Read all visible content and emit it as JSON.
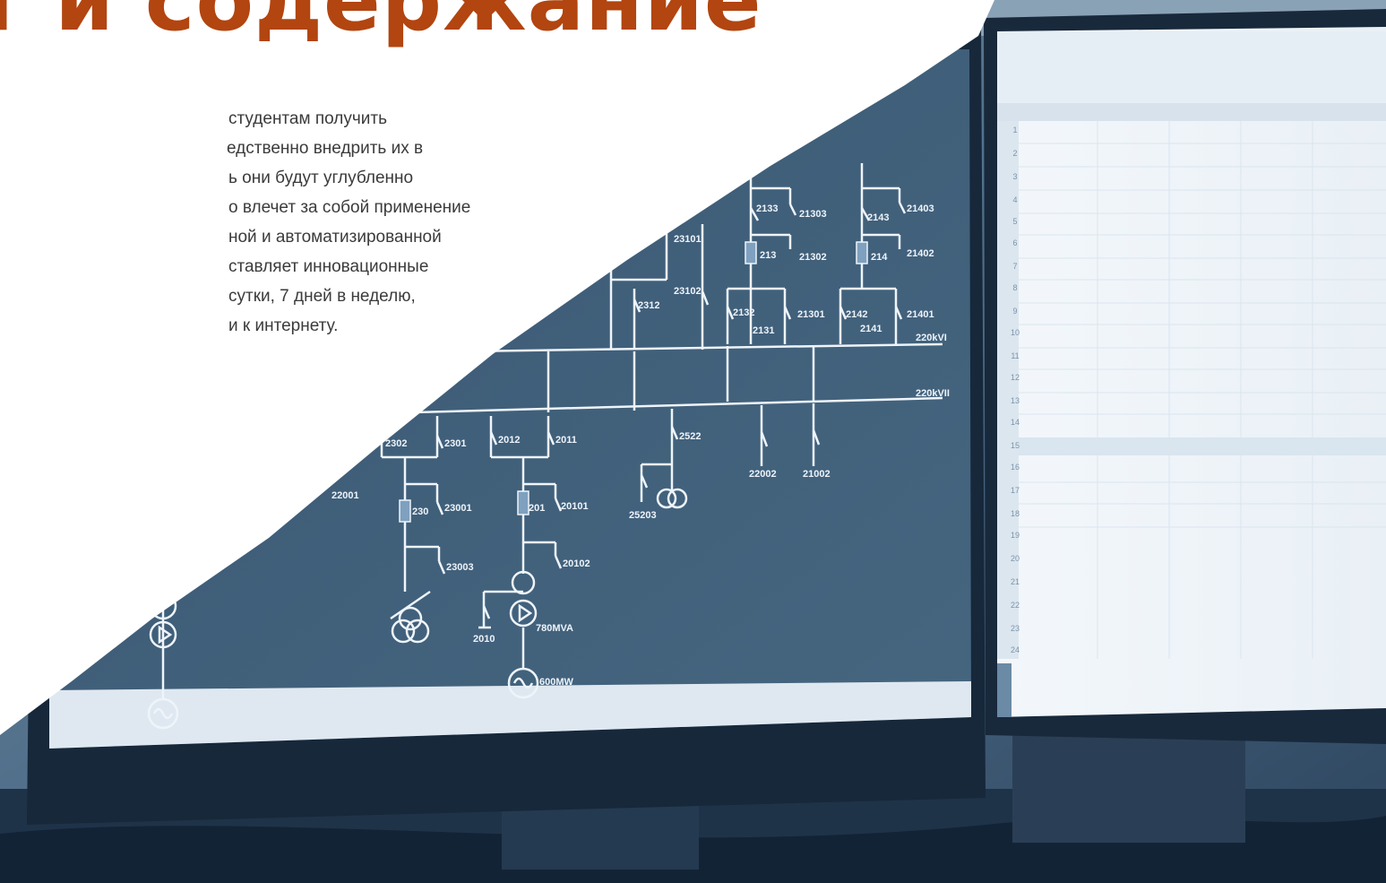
{
  "heading": {
    "text": "т и содержание",
    "color": "#b24510"
  },
  "body_lines": [
    "студентам получить",
    "едственно внедрить их в",
    "ь они будут углубленно",
    "о влечет за собой применение",
    "ной и автоматизированной",
    "ставляет инновационные",
    "сутки, 7 дней в неделю,",
    "и к интернету."
  ],
  "diagram_labels": {
    "l2133": "2133",
    "l21303": "21303",
    "l213": "213",
    "l21302": "21302",
    "l2132": "2132",
    "l21301": "21301",
    "l2131": "2131",
    "l2143": "2143",
    "l21403": "21403",
    "l214": "214",
    "l21402": "21402",
    "l2142": "2142",
    "l21401": "21401",
    "l2141": "2141",
    "l2312": "2312",
    "l23102": "23102",
    "l23101": "23101",
    "bus1": "220kVI",
    "bus2": "220kVII",
    "l2302": "2302",
    "l2301": "2301",
    "l2012": "2012",
    "l2011": "2011",
    "l2522": "2522",
    "l22002": "22002",
    "l21002": "21002",
    "l22001": "22001",
    "l230": "230",
    "l23001": "23001",
    "l23003": "23003",
    "l201": "201",
    "l20101": "20101",
    "l20102": "20102",
    "l25203": "25203",
    "l2010": "2010",
    "rating_mva": "780MVA",
    "rating_mw": "600MW"
  },
  "spreadsheet": {
    "row_numbers": [
      "1",
      "2",
      "3",
      "4",
      "5",
      "6",
      "7",
      "8",
      "9",
      "10",
      "11",
      "12",
      "13",
      "14",
      "15",
      "16",
      "17",
      "18",
      "19",
      "20",
      "21",
      "22",
      "23",
      "24"
    ]
  },
  "colors": {
    "accent": "#b24510",
    "screen": "#3d5b76",
    "diagram_line": "#eef4fa",
    "background": "#ffffff"
  }
}
